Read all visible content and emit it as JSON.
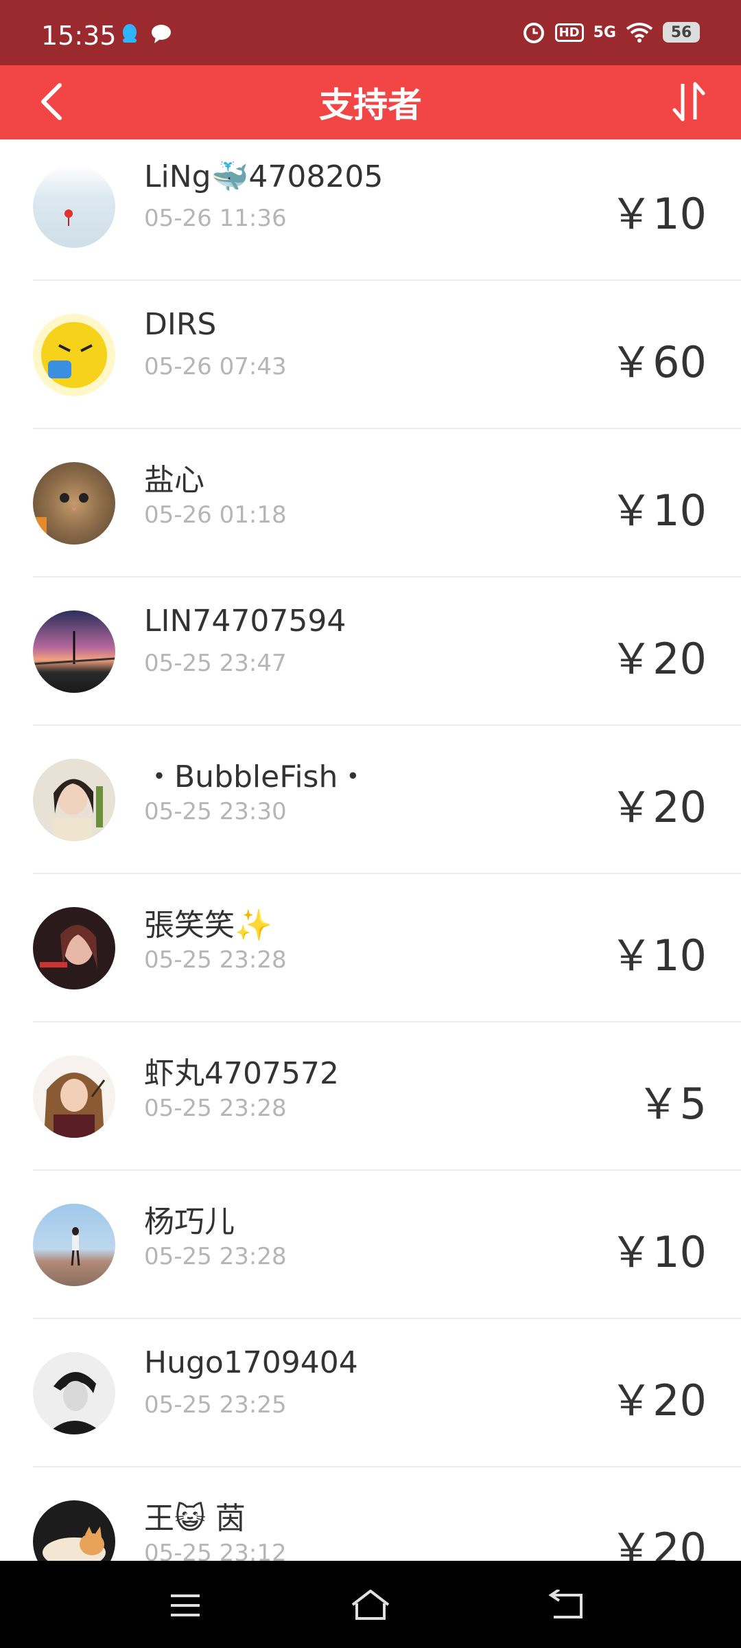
{
  "status": {
    "time": "15:35",
    "net": "5G",
    "hd": "HD",
    "battery": "56"
  },
  "header": {
    "title": "支持者"
  },
  "supporters": [
    {
      "name": "LiNg🐳4708205",
      "time": "05-26 11:36",
      "amount": "￥10"
    },
    {
      "name": "DIRS",
      "time": "05-26 07:43",
      "amount": "￥60"
    },
    {
      "name": "盐心",
      "time": "05-26 01:18",
      "amount": "￥10"
    },
    {
      "name": "LIN74707594",
      "time": "05-25 23:47",
      "amount": "￥20"
    },
    {
      "name": "・BubbleFish・",
      "time": "05-25 23:30",
      "amount": "￥20"
    },
    {
      "name": "張笑笑✨",
      "time": "05-25 23:28",
      "amount": "￥10"
    },
    {
      "name": "虾丸4707572",
      "time": "05-25 23:28",
      "amount": "￥5"
    },
    {
      "name": "杨巧儿",
      "time": "05-25 23:28",
      "amount": "￥10"
    },
    {
      "name": "Hugo1709404",
      "time": "05-25 23:25",
      "amount": "￥20"
    },
    {
      "name": "王😺 茵",
      "time": "05-25 23:12",
      "amount": "￥20"
    }
  ],
  "colors": {
    "statusbar": "#9b2a2e",
    "topbar": "#f24646",
    "time_text": "#b5b5b5"
  }
}
